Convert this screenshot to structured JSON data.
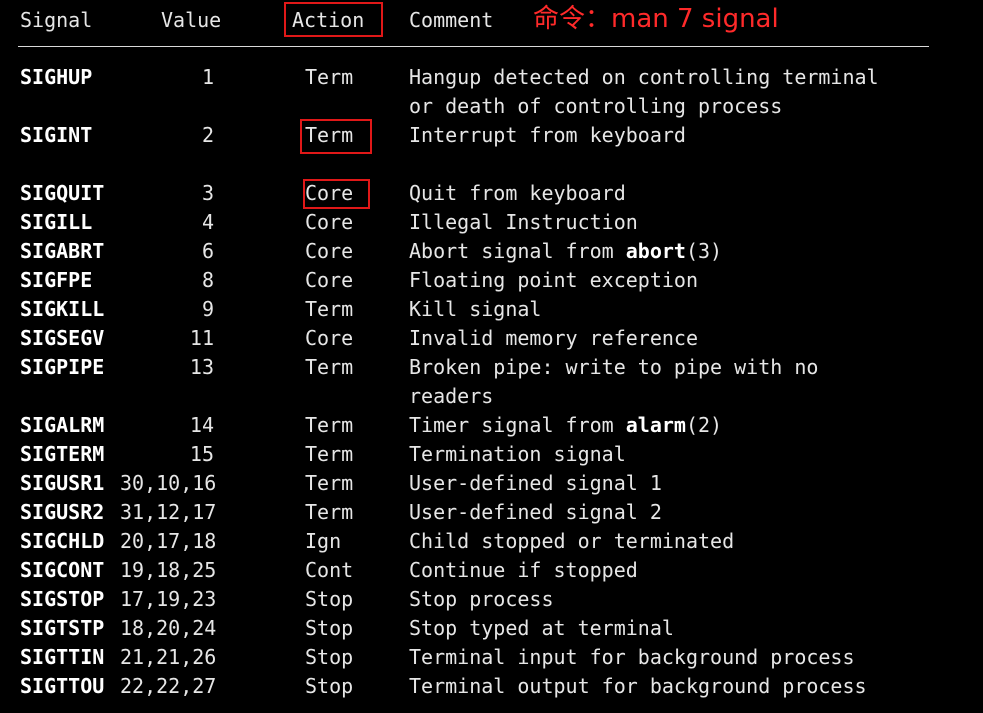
{
  "header": {
    "signal": "Signal",
    "value": "Value",
    "action": "Action",
    "comment": "Comment",
    "note": "命令：man 7 signal"
  },
  "highlight_color": "#e01818",
  "rows": [
    {
      "name": "SIGHUP",
      "value": "1",
      "action": "Term",
      "comment": "Hangup detected on controlling terminal",
      "comment2": "or death of controlling process"
    },
    {
      "name": "SIGINT",
      "value": "2",
      "action": "Term",
      "comment": "Interrupt from keyboard",
      "comment2": ""
    },
    {
      "name": "SIGQUIT",
      "value": "3",
      "action": "Core",
      "comment": "Quit from keyboard"
    },
    {
      "name": "SIGILL",
      "value": "4",
      "action": "Core",
      "comment": "Illegal Instruction"
    },
    {
      "name": "SIGABRT",
      "value": "6",
      "action": "Core",
      "comment_pre": "Abort signal from ",
      "comment_bold": "abort",
      "comment_post": "(3)"
    },
    {
      "name": "SIGFPE",
      "value": "8",
      "action": "Core",
      "comment": "Floating point exception"
    },
    {
      "name": "SIGKILL",
      "value": "9",
      "action": "Term",
      "comment": "Kill signal"
    },
    {
      "name": "SIGSEGV",
      "value": "11",
      "action": "Core",
      "comment": "Invalid memory reference"
    },
    {
      "name": "SIGPIPE",
      "value": "13",
      "action": "Term",
      "comment": "Broken pipe: write to pipe with no",
      "comment2": "readers"
    },
    {
      "name": "SIGALRM",
      "value": "14",
      "action": "Term",
      "comment_pre": "Timer signal from ",
      "comment_bold": "alarm",
      "comment_post": "(2)"
    },
    {
      "name": "SIGTERM",
      "value": "15",
      "action": "Term",
      "comment": "Termination signal"
    },
    {
      "name": "SIGUSR1",
      "value": "30,10,16",
      "action": "Term",
      "comment": "User-defined signal 1"
    },
    {
      "name": "SIGUSR2",
      "value": "31,12,17",
      "action": "Term",
      "comment": "User-defined signal 2"
    },
    {
      "name": "SIGCHLD",
      "value": "20,17,18",
      "action": "Ign",
      "comment": "Child stopped or terminated"
    },
    {
      "name": "SIGCONT",
      "value": "19,18,25",
      "action": "Cont",
      "comment": "Continue if stopped"
    },
    {
      "name": "SIGSTOP",
      "value": "17,19,23",
      "action": "Stop",
      "comment": "Stop process"
    },
    {
      "name": "SIGTSTP",
      "value": "18,20,24",
      "action": "Stop",
      "comment": "Stop typed at terminal"
    },
    {
      "name": "SIGTTIN",
      "value": "21,21,26",
      "action": "Stop",
      "comment": "Terminal input for background process"
    },
    {
      "name": "SIGTTOU",
      "value": "22,22,27",
      "action": "Stop",
      "comment": "Terminal output for background process"
    }
  ]
}
